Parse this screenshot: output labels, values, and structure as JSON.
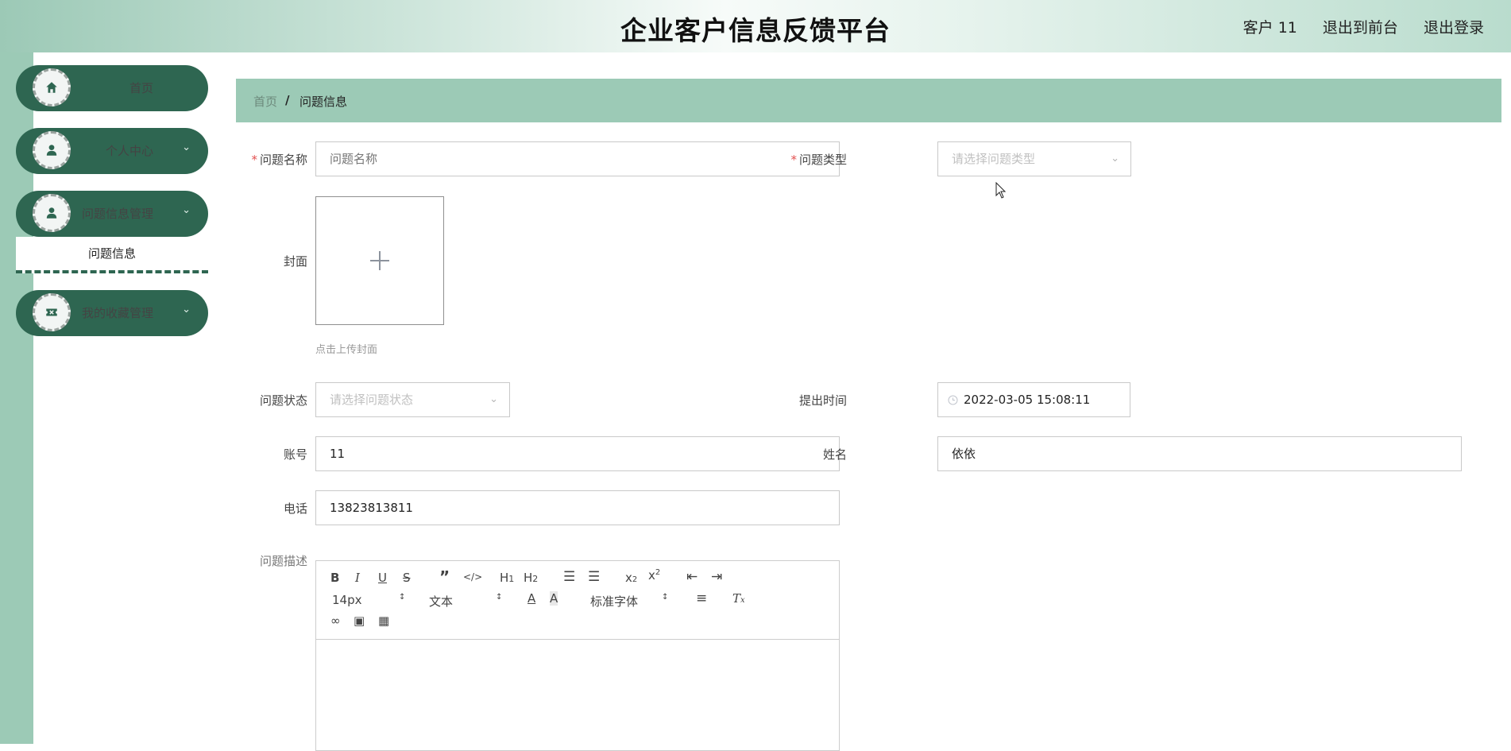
{
  "header": {
    "title": "企业客户信息反馈平台",
    "user": "客户 11",
    "front_link": "退出到前台",
    "logout": "退出登录"
  },
  "sidebar": {
    "items": [
      {
        "label": "首页",
        "icon": "home-icon"
      },
      {
        "label": "个人中心",
        "icon": "user-icon"
      },
      {
        "label": "问题信息管理",
        "icon": "user-icon"
      },
      {
        "label": "我的收藏管理",
        "icon": "ticket-icon"
      }
    ],
    "submenu_label": "问题信息"
  },
  "breadcrumb": {
    "home": "首页",
    "separator": "/",
    "current": "问题信息"
  },
  "form": {
    "name": {
      "label": "问题名称",
      "placeholder": "问题名称",
      "value": ""
    },
    "type": {
      "label": "问题类型",
      "placeholder": "请选择问题类型"
    },
    "cover": {
      "label": "封面",
      "tip": "点击上传封面"
    },
    "status": {
      "label": "问题状态",
      "placeholder": "请选择问题状态"
    },
    "time": {
      "label": "提出时间",
      "value": "2022-03-05 15:08:11"
    },
    "account": {
      "label": "账号",
      "value": "11"
    },
    "realname": {
      "label": "姓名",
      "value": "依依"
    },
    "phone": {
      "label": "电话",
      "value": "13823813811"
    },
    "description": {
      "label": "问题描述"
    }
  },
  "editor": {
    "font_size": "14px",
    "paragraph": "文本",
    "font_family": "标准字体"
  },
  "colors": {
    "primary": "#2e6651",
    "accent": "#9ccab6",
    "required": "#e2504f"
  }
}
